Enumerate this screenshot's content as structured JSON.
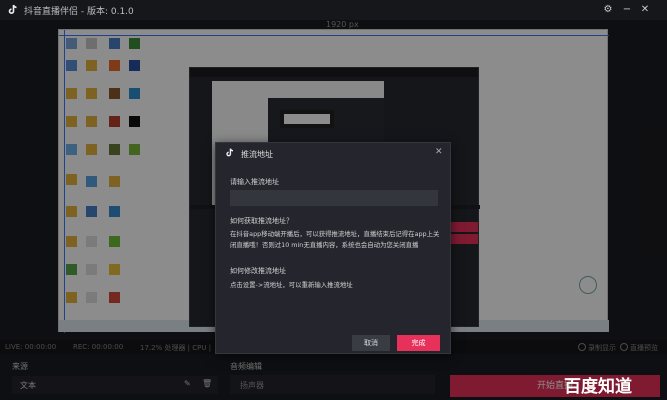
{
  "window": {
    "title": "抖音直播伴侣 - 版本: 0.1.0",
    "settings_icon": "gear-icon",
    "minimize_icon": "minimize-icon",
    "close_icon": "close-icon"
  },
  "preview": {
    "resolution": "1920 px"
  },
  "statusbar": {
    "live": "LIVE: 00:00:00",
    "rec": "REC: 00:00:00",
    "cpu": "17.2% 处理器 | CPU |",
    "option1": "录制显示",
    "option2": "直播预览"
  },
  "panels": {
    "source_title": "来源",
    "source_item": "文本",
    "mixer_title": "音频编辑",
    "mixer_item": "扬声器",
    "start_button": "开始直播"
  },
  "modal": {
    "title": "推流地址",
    "input_label": "请输入推流地址",
    "input_placeholder": "",
    "q1": "如何获取推流地址？",
    "a1": "在抖音app移动端开播后，可以获得推流地址，直播结束后记得在app上关闭直播哦！否则过10 min无直播内容，系统也会自动为您关闭直播",
    "q2": "如何修改推流地址",
    "a2": "点击设置->流地址，可以重新输入推流地址",
    "cancel": "取消",
    "done": "完成"
  },
  "watermark": {
    "text": "百度知道"
  },
  "colors": {
    "accent": "#e8315a",
    "background": "#1b1c21",
    "modal_bg": "#25262d"
  }
}
